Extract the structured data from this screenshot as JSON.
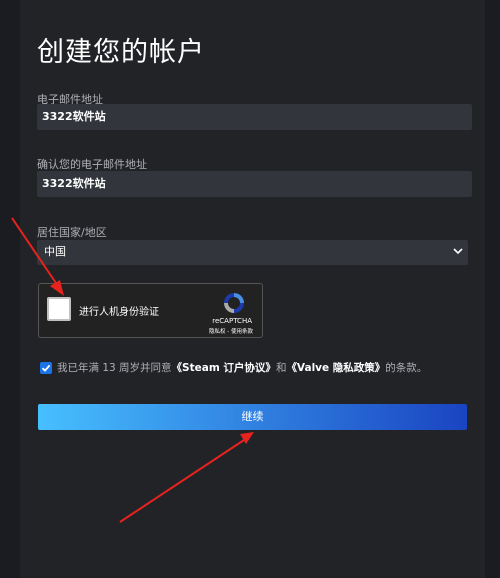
{
  "page": {
    "title": "创建您的帐户"
  },
  "form": {
    "email_label": "电子邮件地址",
    "email_value": "3322软件站",
    "confirm_email_label": "确认您的电子邮件地址",
    "confirm_email_value": "3322软件站",
    "country_label": "居住国家/地区",
    "country_value": "中国"
  },
  "captcha": {
    "text": "进行人机身份验证",
    "brand": "reCAPTCHA",
    "links": "隐私权 - 使用条款",
    "checked": false
  },
  "agreement": {
    "checked": true,
    "prefix": "我已年满 13 周岁并同意",
    "link1": "《Steam 订户协议》",
    "middle": "和",
    "link2": "《Valve 隐私政策》",
    "suffix": "的条款。"
  },
  "continue_label": "继续",
  "colors": {
    "annotation_arrow": "#e8231d",
    "button_gradient_start": "#47bfff",
    "button_gradient_end": "#1a44c2",
    "checkbox_accent": "#1a73e8"
  }
}
